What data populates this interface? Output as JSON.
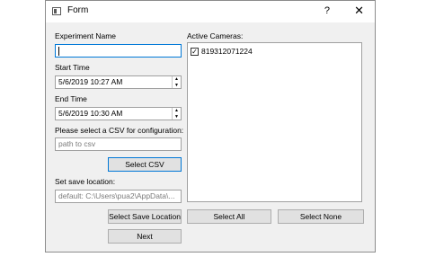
{
  "window": {
    "title": "Form",
    "help_glyph": "?",
    "close_glyph": "✕"
  },
  "form": {
    "experiment_name_label": "Experiment Name",
    "experiment_name_value": "",
    "start_time_label": "Start Time",
    "start_time_value": "5/6/2019 10:27 AM",
    "end_time_label": "End Time",
    "end_time_value": "5/6/2019 10:30 AM",
    "csv_label": "Please select a CSV for configuration:",
    "csv_placeholder": "path to csv",
    "select_csv_button": "Select CSV",
    "save_location_label": "Set save location:",
    "save_location_value": "default: C:\\Users\\pua2\\AppData\\...",
    "select_save_location_button": "Select Save Location",
    "next_button": "Next"
  },
  "cameras": {
    "label": "Active Cameras:",
    "items": [
      {
        "checked": true,
        "name": "819312071224"
      }
    ],
    "select_all_button": "Select All",
    "select_none_button": "Select None"
  },
  "icons": {
    "spin_up": "▲",
    "spin_down": "▼",
    "check": "✓"
  }
}
